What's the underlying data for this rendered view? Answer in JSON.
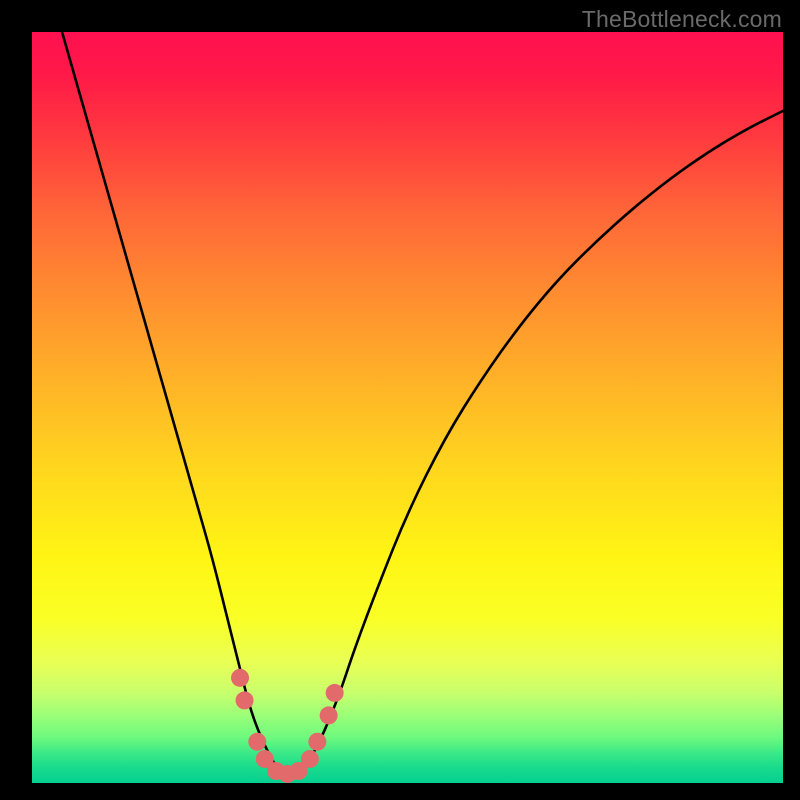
{
  "watermark": "TheBottleneck.com",
  "chart_data": {
    "type": "line",
    "title": "",
    "xlabel": "",
    "ylabel": "",
    "xlim": [
      0,
      100
    ],
    "ylim": [
      0,
      100
    ],
    "grid": false,
    "series": [
      {
        "name": "curve",
        "color": "#000000",
        "x": [
          4,
          6,
          8,
          10,
          12,
          14,
          16,
          18,
          20,
          22,
          24,
          26,
          27.5,
          29,
          30.5,
          32,
          33,
          34,
          35,
          37,
          39,
          41,
          43,
          46,
          50,
          55,
          60,
          65,
          70,
          75,
          80,
          85,
          90,
          95,
          100
        ],
        "y": [
          100,
          93,
          86,
          79,
          72,
          65,
          58,
          51,
          44,
          37,
          30,
          22,
          16,
          10,
          6,
          3,
          1.5,
          1,
          1.5,
          3,
          7,
          12,
          18,
          26,
          36,
          46,
          54,
          61,
          67,
          72,
          76.5,
          80.5,
          84,
          87,
          89.5
        ]
      },
      {
        "name": "baseline",
        "color": "#05d091",
        "x": [
          0,
          100
        ],
        "y": [
          0,
          0
        ]
      }
    ],
    "markers": {
      "name": "highlighted-points",
      "color": "#e36a6a",
      "points": [
        {
          "x": 27.7,
          "y": 14
        },
        {
          "x": 28.3,
          "y": 11
        },
        {
          "x": 30.0,
          "y": 5.5
        },
        {
          "x": 31.0,
          "y": 3.2
        },
        {
          "x": 32.5,
          "y": 1.6
        },
        {
          "x": 34.0,
          "y": 1.2
        },
        {
          "x": 35.5,
          "y": 1.6
        },
        {
          "x": 37.0,
          "y": 3.2
        },
        {
          "x": 38.0,
          "y": 5.5
        },
        {
          "x": 39.5,
          "y": 9
        },
        {
          "x": 40.3,
          "y": 12
        }
      ]
    }
  }
}
